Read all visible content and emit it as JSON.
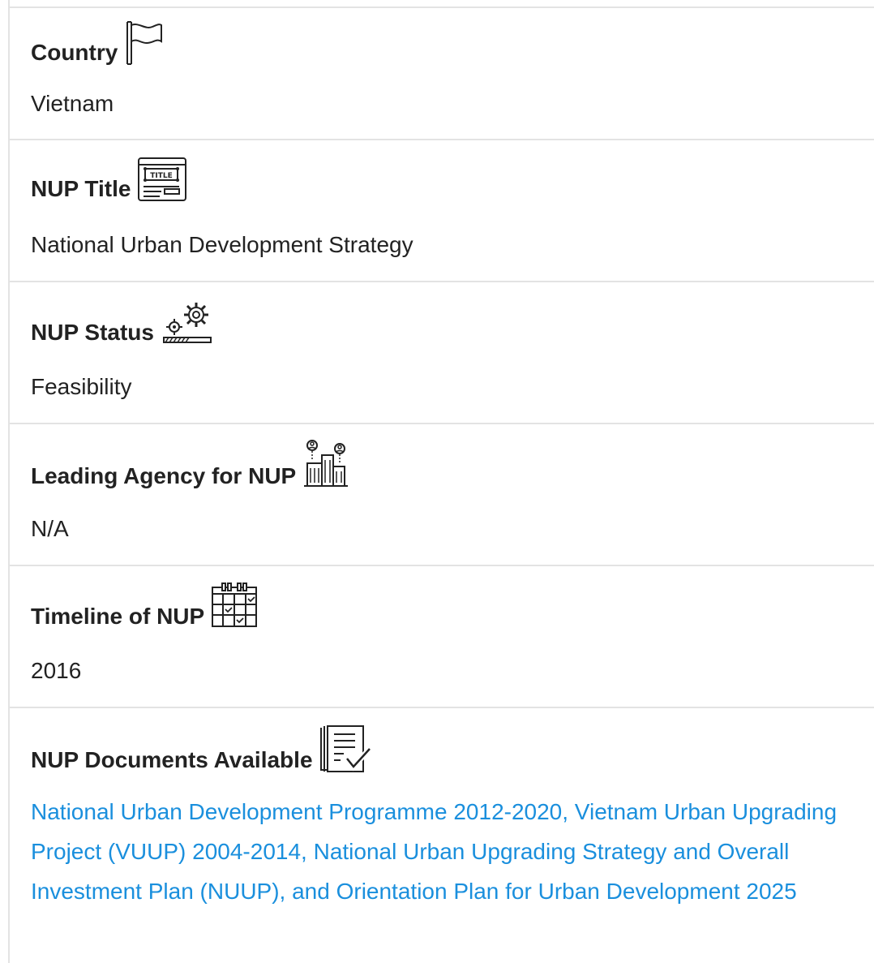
{
  "sections": {
    "country": {
      "label": "Country",
      "value": "Vietnam",
      "icon": "flag-icon"
    },
    "title": {
      "label": "NUP Title",
      "value": "National Urban Development Strategy",
      "icon": "title-icon"
    },
    "status": {
      "label": "NUP Status",
      "value": "Feasibility",
      "icon": "gears-icon"
    },
    "agency": {
      "label": "Leading Agency for NUP",
      "value": "N/A",
      "icon": "buildings-people-icon"
    },
    "timeline": {
      "label": "Timeline of NUP",
      "value": "2016",
      "icon": "calendar-icon"
    },
    "documents": {
      "label": "NUP Documents Available",
      "icon": "document-check-icon",
      "link_text": "National Urban Development Programme 2012-2020, Vietnam Urban Upgrading Project (VUUP) 2004-2014, National Urban Upgrading Strategy and Overall Investment Plan (NUUP), and Orientation Plan for Urban Development 2025",
      "link_color": "#1a8fdd"
    }
  }
}
